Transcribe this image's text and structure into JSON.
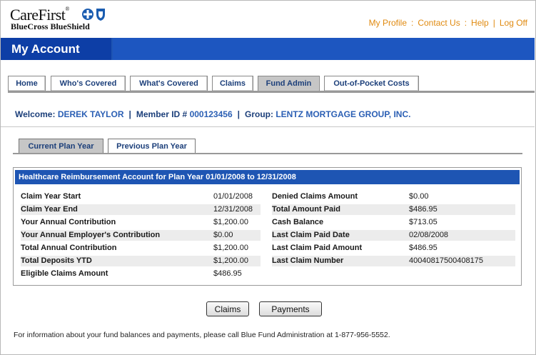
{
  "brand": {
    "name": "CareFirst",
    "tm": "®",
    "sub": "BlueCross BlueShield",
    "cross_color": "#1a5cb0",
    "shield_color": "#1a5cb0"
  },
  "top_links": [
    {
      "label": "My Profile"
    },
    {
      "label": "Contact Us"
    },
    {
      "label": "Help"
    },
    {
      "label": "Log Off"
    }
  ],
  "top_link_separators": [
    ":",
    ":",
    "|"
  ],
  "page_title": "My Account",
  "tabs": [
    {
      "label": "Home"
    },
    {
      "label": "Who's Covered"
    },
    {
      "label": "What's Covered"
    },
    {
      "label": "Claims"
    },
    {
      "label": "Fund Admin"
    },
    {
      "label": "Out-of-Pocket Costs"
    }
  ],
  "welcome": {
    "label": "Welcome:",
    "name": "DEREK TAYLOR",
    "member_label": "Member ID #",
    "member_id": "000123456",
    "group_label": "Group:",
    "group_name": "LENTZ MORTGAGE GROUP, INC."
  },
  "plan_tabs": [
    {
      "label": "Current Plan Year"
    },
    {
      "label": "Previous Plan Year"
    }
  ],
  "account": {
    "heading": "Healthcare Reimbursement Account for Plan Year 01/01/2008 to 12/31/2008",
    "left": [
      {
        "label": "Claim Year Start",
        "value": "01/01/2008"
      },
      {
        "label": "Claim Year End",
        "value": "12/31/2008"
      },
      {
        "label": "Your Annual Contribution",
        "value": "$1,200.00"
      },
      {
        "label": "Your Annual Employer's Contribution",
        "value": "$0.00"
      },
      {
        "label": "Total Annual Contribution",
        "value": "$1,200.00"
      },
      {
        "label": "Total Deposits YTD",
        "value": "$1,200.00"
      },
      {
        "label": "Eligible Claims Amount",
        "value": "$486.95"
      }
    ],
    "right": [
      {
        "label": "Denied Claims Amount",
        "value": "$0.00"
      },
      {
        "label": "Total Amount Paid",
        "value": "$486.95"
      },
      {
        "label": "Cash Balance",
        "value": "$713.05"
      },
      {
        "label": "Last Claim Paid Date",
        "value": "02/08/2008"
      },
      {
        "label": "Last Claim Paid Amount",
        "value": "$486.95"
      },
      {
        "label": "Last Claim Number",
        "value": "40040817500408175"
      }
    ]
  },
  "buttons": {
    "claims": "Claims",
    "payments": "Payments"
  },
  "footer_note": "For information about your fund balances and payments, please call Blue Fund Administration at 1-877-956-5552."
}
